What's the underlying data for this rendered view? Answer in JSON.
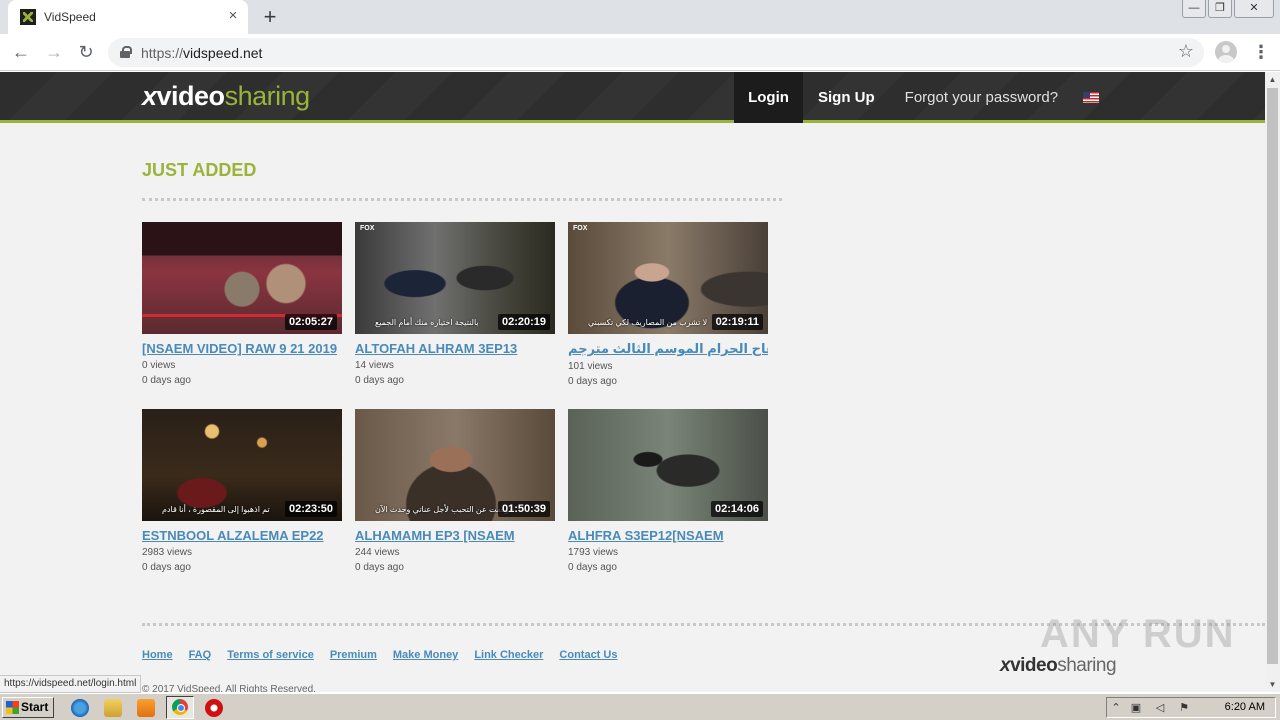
{
  "browser": {
    "tab_title": "VidSpeed",
    "tab_close": "×",
    "new_tab": "+",
    "url_scheme": "https://",
    "url_host": "vidspeed.net",
    "back": "←",
    "forward": "→",
    "reload": "↻",
    "star": "☆",
    "menu": "⋮",
    "window_controls": {
      "minimize": "—",
      "restore": "❐",
      "close": "✕"
    }
  },
  "site": {
    "logo": {
      "x": "x",
      "video": "video",
      "sharing": "sharing"
    },
    "nav": {
      "login": "Login",
      "signup": "Sign Up",
      "forgot": "Forgot your password?"
    },
    "section_title": "JUST ADDED",
    "videos": [
      {
        "title": "[NSAEM VIDEO] RAW 9 21 2019",
        "duration": "02:05:27",
        "views": "0 views",
        "age": "0 days ago",
        "subtitle": "",
        "channel": ""
      },
      {
        "title": "ALTOFAH ALHRAM 3EP13",
        "duration": "02:20:19",
        "views": "14 views",
        "age": "0 days ago",
        "subtitle": "بالنتيجة اختياره منك أمام الجميع",
        "channel": "FOX"
      },
      {
        "title": "التفاح الحرام الموسم الثالث مترجم �...",
        "duration": "02:19:11",
        "views": "101 views",
        "age": "0 days ago",
        "subtitle": "لا تشرب من المصاريف لكي تكسبني",
        "channel": "FOX"
      },
      {
        "title": "ESTNBOOL ALZALEMA EP22",
        "duration": "02:23:50",
        "views": "2983 views",
        "age": "0 days ago",
        "subtitle": "تم اذهبوا إلى المقصورة ، أنا قادم",
        "channel": ""
      },
      {
        "title": "ALHAMAMH EP3 [NSAEM",
        "duration": "01:50:39",
        "views": "244 views",
        "age": "0 days ago",
        "subtitle": "توقفت عن التحبب لأجل عناتي وحدث الآن",
        "channel": ""
      },
      {
        "title": "ALHFRA S3EP12[NSAEM",
        "duration": "02:14:06",
        "views": "1793 views",
        "age": "0 days ago",
        "subtitle": "",
        "channel": ""
      }
    ],
    "footer_links": [
      "Home",
      "FAQ",
      "Terms of service",
      "Premium",
      "Make Money",
      "Link Checker",
      "Contact Us"
    ],
    "copyright": "© 2017 VidSpeed. All Rights Reserved.",
    "status_url": "https://vidspeed.net/login.html",
    "watermark": "ANY RUN"
  },
  "taskbar": {
    "start": "Start",
    "clock": "6:20 AM"
  },
  "colors": {
    "accent_green": "#9ab33a",
    "link_blue": "#4a8ab8",
    "header_dark": "#2e2e2e"
  },
  "icons": [
    "favicon-icon",
    "lock-icon",
    "star-icon",
    "profile-icon",
    "menu-icon",
    "flag-us-icon",
    "start-logo-icon",
    "ie-icon",
    "folder-icon",
    "media-player-icon",
    "chrome-icon",
    "opera-icon"
  ]
}
